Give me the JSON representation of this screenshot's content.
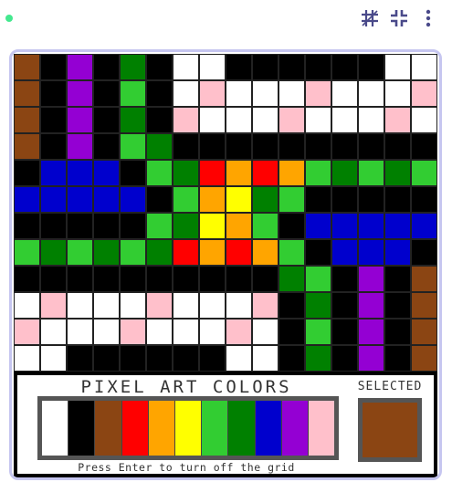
{
  "palette_title": "PIXEL ART COLORS",
  "selected_label": "SELECTED",
  "hint": "Press Enter to turn off the grid",
  "selected_color": "#8b4513",
  "colors": {
    "W": "#ffffff",
    "K": "#000000",
    "N": "#8b4513",
    "R": "#ff0000",
    "O": "#ffa500",
    "Y": "#ffff00",
    "G": "#32cd32",
    "D": "#008000",
    "B": "#0000cd",
    "P": "#9400d3",
    "S": "#ffc0cb"
  },
  "palette": [
    "#ffffff",
    "#000000",
    "#8b4513",
    "#ff0000",
    "#ffa500",
    "#ffff00",
    "#32cd32",
    "#008000",
    "#0000cd",
    "#9400d3",
    "#ffc0cb"
  ],
  "pixel_rows": [
    "NKPKDKWWKKKKKKWW",
    "NKPKGKWSWWWSWWWS",
    "NKPKDKSWWWSWWWSW",
    "NKPKGDKKKKKKKKKK",
    "KBBBKGDROROGDGDG",
    "BBBBBKGOYDGKKKKK",
    "KKKKKGDYOGKBBBBB",
    "GDGDGDROROGKBBBK",
    "KKKKKKKKKKDGKPKN",
    "WSWWWSWWWSKDKPKN",
    "SWWWSWWWSWKGKPKN",
    "WWKKKKKKWWKDKPKN"
  ]
}
